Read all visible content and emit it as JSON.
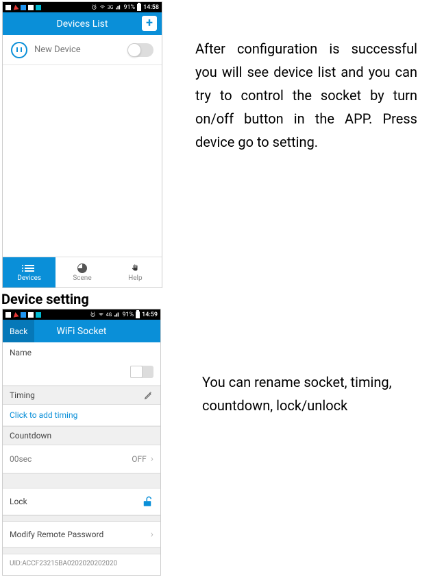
{
  "phone1": {
    "status": {
      "time": "14:58",
      "battery_pct": "91%",
      "network": "3G",
      "signal": "▮▮▮"
    },
    "header": {
      "title": "Devices List",
      "add_label": "+"
    },
    "devices": [
      {
        "name": "New Device",
        "on": false
      }
    ],
    "tabs": {
      "devices": "Devices",
      "scene": "Scene",
      "help": "Help"
    }
  },
  "phone2": {
    "status": {
      "time": "14:59",
      "battery_pct": "91%",
      "network": "4G"
    },
    "header": {
      "back": "Back",
      "title": "WiFi Socket"
    },
    "name_section": {
      "label": "Name",
      "value": ""
    },
    "timing_section": {
      "label": "Timing",
      "link": "Click to add timing"
    },
    "countdown_section": {
      "label": "Countdown",
      "value": "00sec",
      "state": "OFF"
    },
    "lock_section": {
      "label": "Lock"
    },
    "password_section": {
      "label": "Modify Remote Password"
    },
    "uid": "UID:ACCF23215BA0202020202020"
  },
  "doc": {
    "para1": "After configuration is successful you will see device list and you can try to control the socket by turn on/off button in the APP. Press device go to setting.",
    "heading": "Device setting",
    "para2": "You can rename socket, timing, countdown, lock/unlock"
  }
}
